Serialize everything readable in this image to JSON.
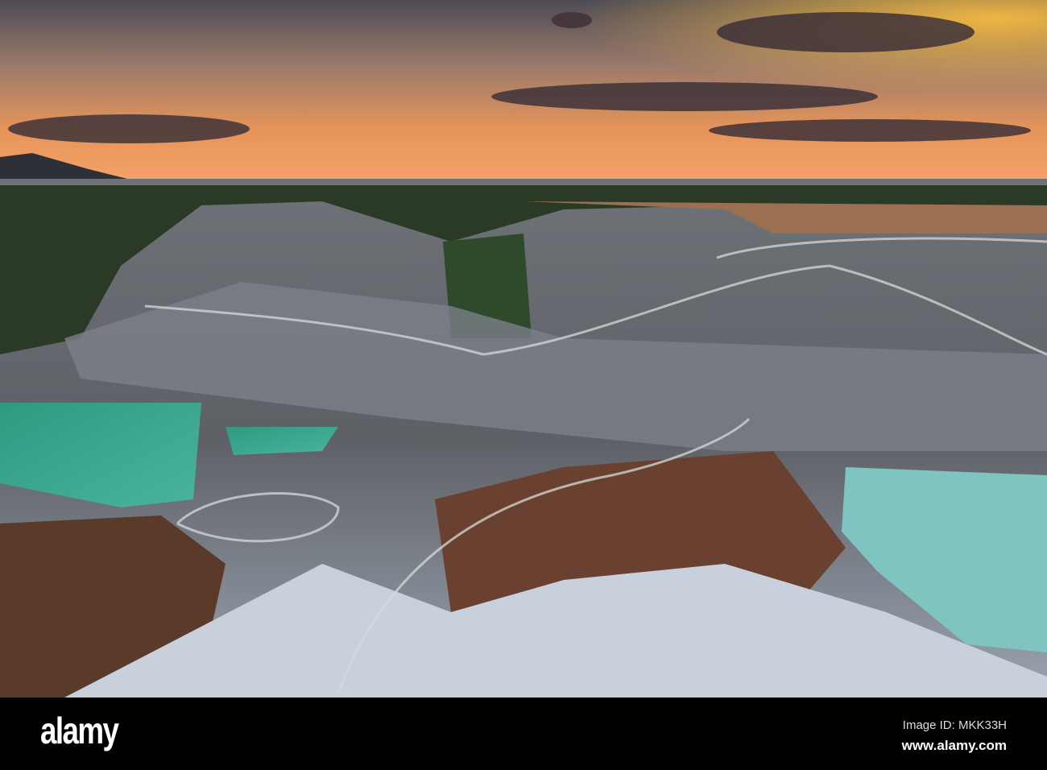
{
  "watermark": {
    "brand": "alamy"
  },
  "footer": {
    "logo": "alamy",
    "image_id": "Image ID: MKK33H",
    "website": "www.alamy.com"
  },
  "colors": {
    "sky_top": "#4a4a58",
    "sky_glow": "#f08a3c",
    "water": "#3aa28c",
    "rock": "#8a8e94"
  }
}
